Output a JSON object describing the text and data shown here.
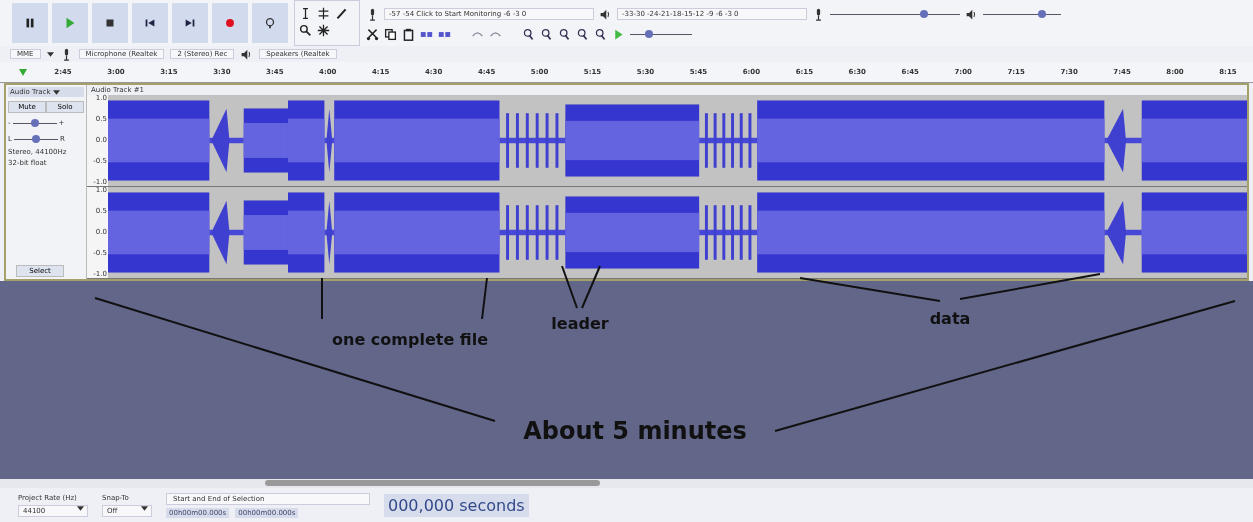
{
  "meters": {
    "record_scale": "-57 -54 Click to Start Monitoring -6 -3 0",
    "playback_scale": "-33-30  -24-21-18-15-12 -9 -6 -3 0"
  },
  "mixer": {
    "record": {
      "level": 0.72
    },
    "playback": {
      "level": 0.76
    }
  },
  "play_at_speed": {
    "level": 0.3
  },
  "device_toolbar": {
    "host": "MME",
    "recording_device": "Microphone (Realtek",
    "channels": "2 (Stereo) Rec",
    "playback_device": "Speakers (Realtek"
  },
  "ruler": {
    "ticks": [
      "2:45",
      "3:00",
      "3:15",
      "3:30",
      "3:45",
      "4:00",
      "4:15",
      "4:30",
      "4:45",
      "5:00",
      "5:15",
      "5:30",
      "5:45",
      "6:00",
      "6:15",
      "6:30",
      "6:45",
      "7:00",
      "7:15",
      "7:30",
      "7:45",
      "8:00",
      "8:15"
    ]
  },
  "track": {
    "menu": "Audio Track",
    "title": "Audio Track #1",
    "mute": "Mute",
    "solo": "Solo",
    "gain_min": "-",
    "gain_max": "+",
    "gain": {
      "level": 0.5
    },
    "pan_left": "L",
    "pan_right": "R",
    "pan": {
      "level": 0.5
    },
    "info": "Stereo, 44100Hz",
    "format": "32-bit float",
    "select": "Select",
    "scale": [
      [
        "1.0",
        "0.5",
        "0.0",
        "-0.5",
        "-1.0"
      ],
      [
        "1.0",
        "0.5",
        "0.0",
        "-0.5",
        "-1.0"
      ]
    ]
  },
  "annotations": [
    {
      "label": "one complete file"
    },
    {
      "label": "leader"
    },
    {
      "label": "data"
    },
    {
      "label": "About 5 minutes"
    }
  ],
  "selection_bar": {
    "project_rate_label": "Project Rate (Hz)",
    "project_rate": "44100",
    "snap_label": "Snap-To",
    "snap": "Off",
    "selection_mode": "Start and End of Selection",
    "start": "00h00m00.000s",
    "end": "00h00m00.000s",
    "audio_position": "000,000 seconds"
  }
}
